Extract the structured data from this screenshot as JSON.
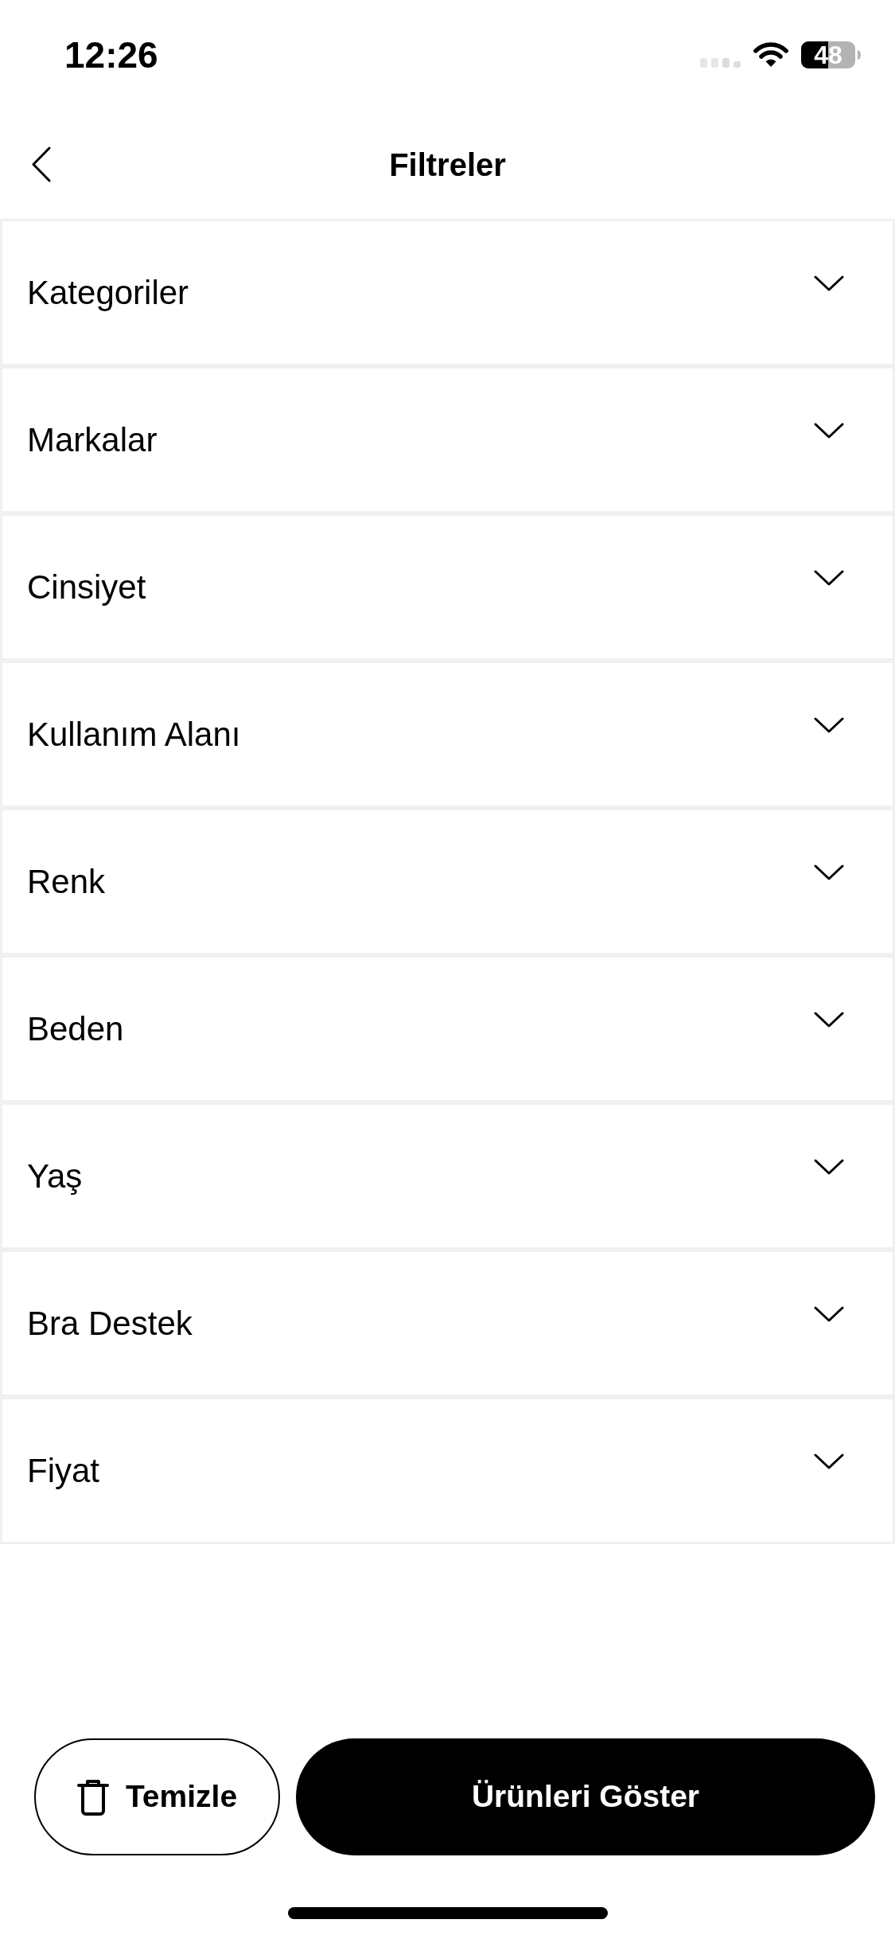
{
  "status_bar": {
    "time": "12:26",
    "battery": "48"
  },
  "header": {
    "title": "Filtreler"
  },
  "filters": [
    {
      "label": "Kategoriler",
      "expanded": false
    },
    {
      "label": "Markalar",
      "expanded": false
    },
    {
      "label": "Cinsiyet",
      "expanded": false
    },
    {
      "label": "Kullanım Alanı",
      "expanded": false
    },
    {
      "label": "Renk",
      "expanded": false
    },
    {
      "label": "Beden",
      "expanded": false
    },
    {
      "label": "Yaş",
      "expanded": false
    },
    {
      "label": "Bra Destek",
      "expanded": false
    },
    {
      "label": "Fiyat",
      "expanded": false
    }
  ],
  "buttons": [
    {
      "kind": "outline",
      "label": "Temizle"
    },
    {
      "kind": "filled",
      "label": "Ürünleri Göster"
    }
  ]
}
